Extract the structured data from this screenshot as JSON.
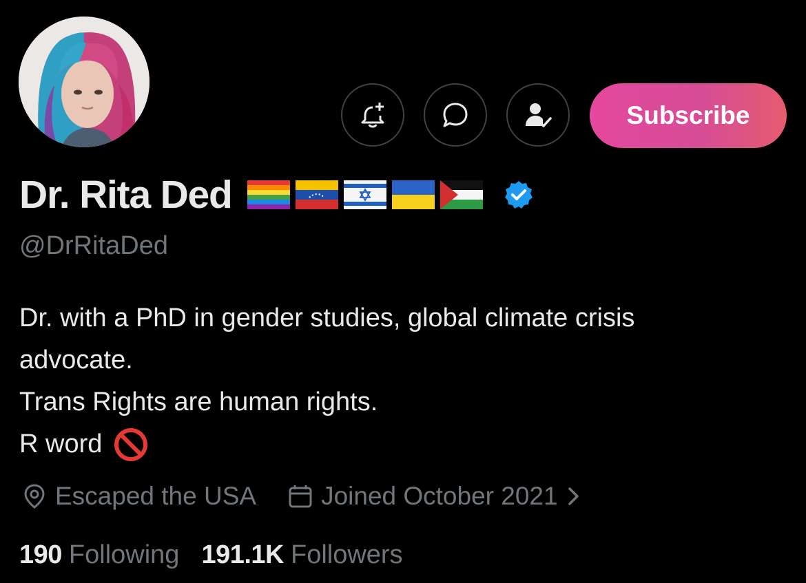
{
  "profile": {
    "name": "Dr. Rita Ded",
    "handle": "@DrRitaDed",
    "flags": [
      "rainbow-flag",
      "venezuela-flag",
      "israel-flag",
      "ukraine-flag",
      "palestine-flag"
    ],
    "verified": true,
    "verified_color": "#1d9bf0"
  },
  "actions": {
    "subscribe_label": "Subscribe",
    "icons": [
      "notification-bell-plus-icon",
      "message-bubble-icon",
      "following-person-check-icon"
    ]
  },
  "bio": {
    "lines": [
      "Dr. with a PhD in gender studies, global climate crisis",
      "advocate.",
      "Trans Rights are human rights.",
      "R word"
    ],
    "emoji": "prohibited-icon"
  },
  "meta": {
    "location": "Escaped the USA",
    "joined": "Joined October 2021"
  },
  "stats": {
    "following_count": "190",
    "following_label": "Following",
    "followers_count": "191.1K",
    "followers_label": "Followers"
  },
  "colors": {
    "background": "#000000",
    "text_primary": "#e7e9ea",
    "text_secondary": "#71767b",
    "subscribe_gradient": [
      "#e5489e",
      "#e45c6f"
    ]
  }
}
